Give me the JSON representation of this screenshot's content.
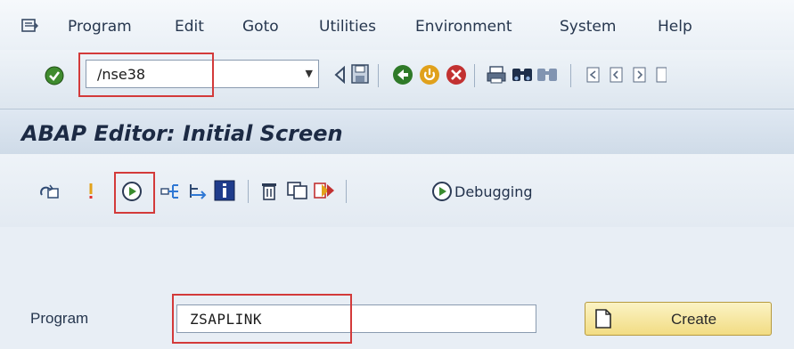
{
  "menubar": {
    "items": [
      "Program",
      "Edit",
      "Goto",
      "Utilities",
      "Environment",
      "System",
      "Help"
    ]
  },
  "toolbar": {
    "command_field": {
      "value": "/nse38"
    }
  },
  "title": "ABAP Editor: Initial Screen",
  "app_toolbar": {
    "debugging_label": "Debugging"
  },
  "form": {
    "program_label": "Program",
    "program_value": "ZSAPLINK",
    "create_label": "Create"
  },
  "colors": {
    "highlight": "#d33a3a",
    "create_button": "#f2dc83",
    "title_text": "#1c2a44"
  }
}
